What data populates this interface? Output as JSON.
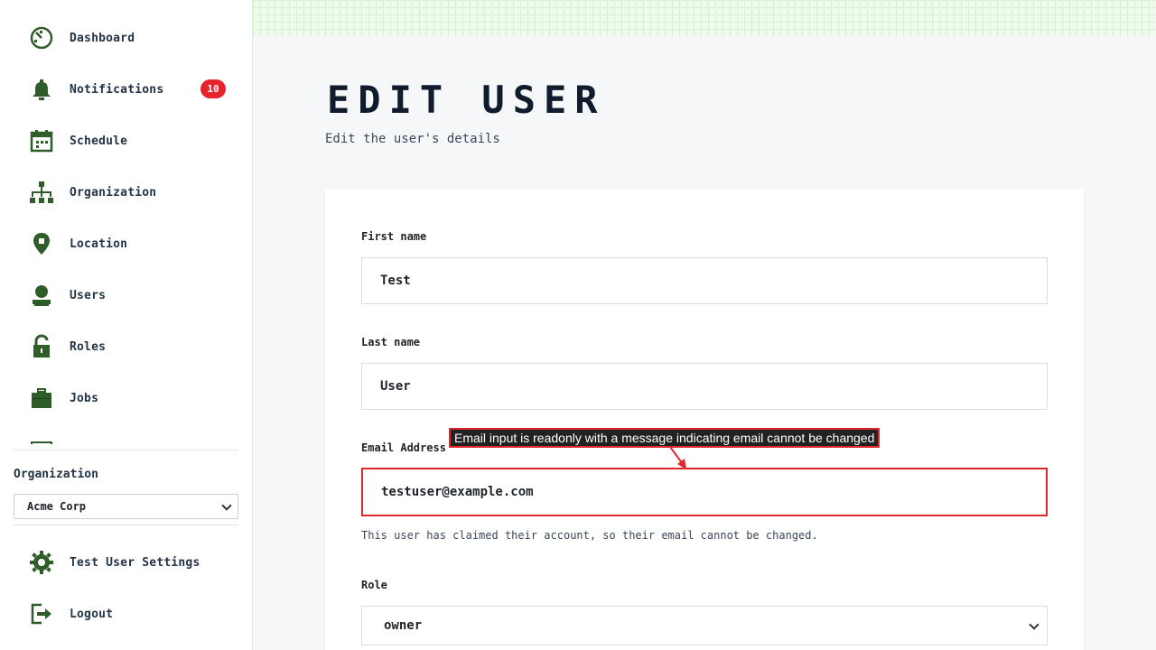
{
  "sidebar": {
    "items": [
      {
        "label": "Dashboard",
        "icon": "dashboard-icon"
      },
      {
        "label": "Notifications",
        "icon": "bell-icon",
        "badge": "10"
      },
      {
        "label": "Schedule",
        "icon": "calendar-icon"
      },
      {
        "label": "Organization",
        "icon": "org-chart-icon"
      },
      {
        "label": "Location",
        "icon": "location-pin-icon"
      },
      {
        "label": "Users",
        "icon": "user-icon"
      },
      {
        "label": "Roles",
        "icon": "padlock-icon"
      },
      {
        "label": "Jobs",
        "icon": "briefcase-icon"
      }
    ],
    "organization_label": "Organization",
    "organization_selected": "Acme Corp",
    "settings_label": "Test User Settings",
    "logout_label": "Logout"
  },
  "page": {
    "title": "EDIT USER",
    "subtitle": "Edit the user's details"
  },
  "form": {
    "first_name_label": "First name",
    "first_name_value": "Test",
    "last_name_label": "Last name",
    "last_name_value": "User",
    "email_label": "Email Address",
    "email_value": "testuser@example.com",
    "email_help": "This user has claimed their account, so their email cannot be changed.",
    "role_label": "Role",
    "role_value": "owner"
  },
  "annotation": {
    "text": "Email input is readonly with a message indicating email cannot be changed"
  },
  "colors": {
    "accent": "#2f5d2a",
    "badge": "#e5242f",
    "highlight": "#e0282c"
  }
}
